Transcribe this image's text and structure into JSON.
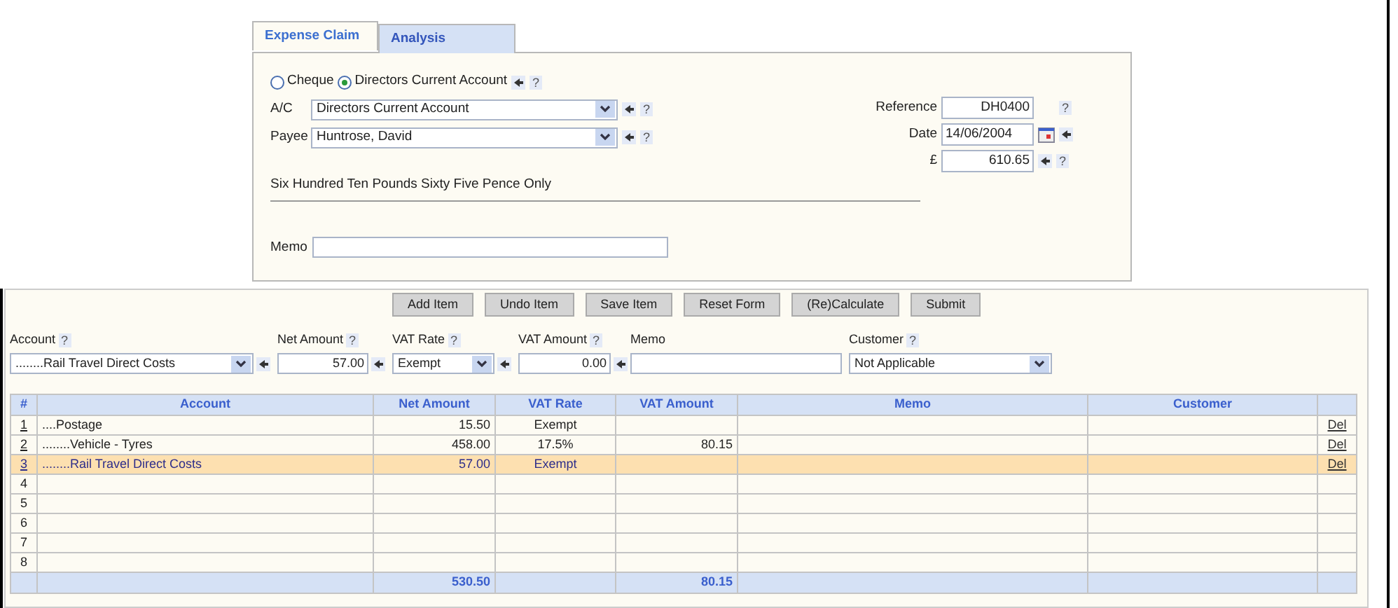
{
  "tabs": [
    {
      "label": "Expense Claim",
      "selected": true
    },
    {
      "label": "Analysis",
      "selected": false
    }
  ],
  "payment_method": {
    "options": [
      {
        "label": "Cheque",
        "selected": false
      },
      {
        "label": "Directors Current Account",
        "selected": true
      }
    ],
    "help": "?"
  },
  "account": {
    "label": "A/C",
    "value": "Directors Current Account",
    "help": "?"
  },
  "payee": {
    "label": "Payee",
    "value": "Huntrose, David",
    "help": "?"
  },
  "reference": {
    "label": "Reference",
    "value": "DH0400",
    "help": "?"
  },
  "date": {
    "label": "Date",
    "value": "14/06/2004"
  },
  "amount": {
    "label": "£",
    "value": "610.65",
    "help": "?"
  },
  "amount_in_words": "Six Hundred Ten Pounds Sixty Five Pence Only",
  "memo": {
    "label": "Memo"
  },
  "buttons": [
    "Add Item",
    "Undo Item",
    "Save Item",
    "Reset Form",
    "(Re)Calculate",
    "Submit"
  ],
  "item_form": [
    {
      "kind": "select",
      "label": "Account",
      "help": "?",
      "value": "........Rail Travel Direct Costs"
    },
    {
      "kind": "number",
      "label": "Net Amount",
      "help": "?",
      "value": "57.00"
    },
    {
      "kind": "select",
      "label": "VAT Rate",
      "help": "?",
      "value": "Exempt"
    },
    {
      "kind": "number",
      "label": "VAT Amount",
      "help": "?",
      "value": "0.00"
    },
    {
      "kind": "text",
      "label": "Memo"
    },
    {
      "kind": "select",
      "label": "Customer",
      "help": "?",
      "value": "Not Applicable"
    }
  ],
  "table": {
    "columns": [
      "#",
      "Account",
      "Net Amount",
      "VAT Rate",
      "VAT Amount",
      "Memo",
      "Customer"
    ],
    "rows": [
      {
        "number": "1",
        "account": "....Postage",
        "net_amount": "15.50",
        "vat_rate": "Exempt",
        "delete": "Del",
        "selected": false
      },
      {
        "number": "2",
        "account": "........Vehicle - Tyres",
        "net_amount": "458.00",
        "vat_rate": "17.5%",
        "vat_amount": "80.15",
        "delete": "Del",
        "selected": false
      },
      {
        "number": "3",
        "account": "........Rail Travel Direct Costs",
        "net_amount": "57.00",
        "vat_rate": "Exempt",
        "delete": "Del",
        "selected": true
      },
      {
        "number": "4",
        "selected": false
      },
      {
        "number": "5",
        "selected": false
      },
      {
        "number": "6",
        "selected": false
      },
      {
        "number": "7",
        "selected": false
      },
      {
        "number": "8",
        "selected": false
      }
    ],
    "totals": {
      "net_amount": "530.50",
      "vat_amount": "80.15"
    }
  }
}
